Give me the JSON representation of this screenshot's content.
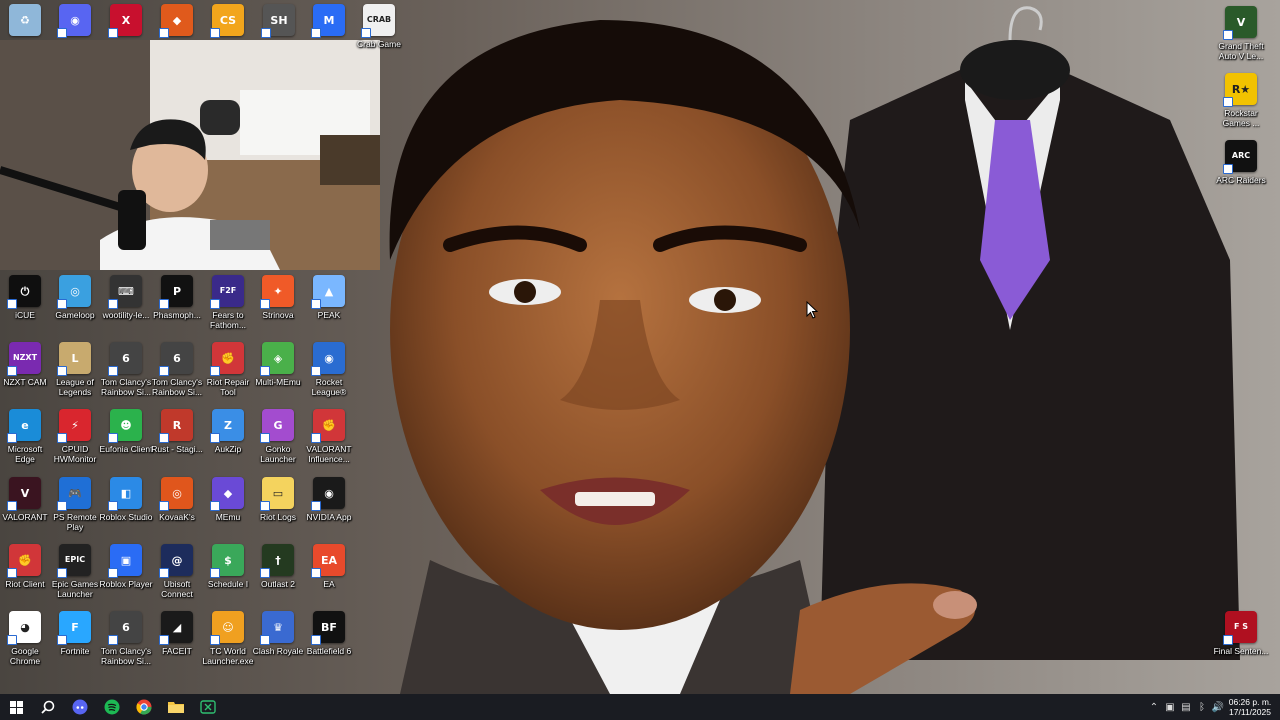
{
  "desktop": {
    "top_row": [
      {
        "name": "recycle-bin",
        "label": "",
        "color": "#8fb7d9",
        "glyph": "♻"
      },
      {
        "name": "discord",
        "label": "",
        "color": "#5865f2",
        "glyph": "◉"
      },
      {
        "name": "app-red-x",
        "label": "",
        "color": "#c8102e",
        "glyph": "X"
      },
      {
        "name": "app-shield",
        "label": "",
        "color": "#e05a1c",
        "glyph": "◆"
      },
      {
        "name": "counter-strike",
        "label": "",
        "color": "#f2a51c",
        "glyph": "CS"
      },
      {
        "name": "silent-hill",
        "label": "",
        "color": "#555",
        "glyph": "SH"
      },
      {
        "name": "app-m",
        "label": "",
        "color": "#2a6cf5",
        "glyph": "M"
      },
      {
        "name": "crab-game",
        "label": "Crab Game",
        "color": "#f0f0f0",
        "glyph": "CRAB"
      }
    ],
    "grid": [
      [
        {
          "label": "iCUE",
          "color": "#0f0f0f",
          "glyph": "⏻"
        },
        {
          "label": "Gameloop",
          "color": "#3aa0e0",
          "glyph": "◎"
        },
        {
          "label": "wootility-le...",
          "color": "#333",
          "glyph": "⌨"
        },
        {
          "label": "Phasmoph...",
          "color": "#111",
          "glyph": "P"
        },
        {
          "label": "Fears to Fathom...",
          "color": "#3a2a8a",
          "glyph": "F2F"
        },
        {
          "label": "Strinova",
          "color": "#f05a28",
          "glyph": "✦"
        },
        {
          "label": "PEAK",
          "color": "#7ab7ff",
          "glyph": "▲"
        }
      ],
      [
        {
          "label": "NZXT CAM",
          "color": "#7a2ab0",
          "glyph": "NZXT"
        },
        {
          "label": "League of Legends",
          "color": "#c8aa6e",
          "glyph": "L"
        },
        {
          "label": "Tom Clancy's Rainbow Si...",
          "color": "#444",
          "glyph": "6"
        },
        {
          "label": "Tom Clancy's Rainbow Si...",
          "color": "#444",
          "glyph": "6"
        },
        {
          "label": "Riot Repair Tool",
          "color": "#d13639",
          "glyph": "✊"
        },
        {
          "label": "Multi-MEmu",
          "color": "#4ab04a",
          "glyph": "◈"
        },
        {
          "label": "Rocket League®",
          "color": "#2a6cd1",
          "glyph": "◉"
        }
      ],
      [
        {
          "label": "Microsoft Edge",
          "color": "#1a8cd8",
          "glyph": "e"
        },
        {
          "label": "CPUID HWMonitor",
          "color": "#d9262e",
          "glyph": "⚡"
        },
        {
          "label": "Eufonia Client",
          "color": "#2bb24c",
          "glyph": "☻"
        },
        {
          "label": "Rust - Stagi...",
          "color": "#c0392b",
          "glyph": "R"
        },
        {
          "label": "AukZip",
          "color": "#3a8ee6",
          "glyph": "Z"
        },
        {
          "label": "Gonko Launcher",
          "color": "#a34ccf",
          "glyph": "G"
        },
        {
          "label": "VALORANT Influence...",
          "color": "#d13639",
          "glyph": "✊"
        }
      ],
      [
        {
          "label": "VALORANT",
          "color": "#3a1420",
          "glyph": "V"
        },
        {
          "label": "PS Remote Play",
          "color": "#1f6fd6",
          "glyph": "🎮"
        },
        {
          "label": "Roblox Studio",
          "color": "#2b8ae6",
          "glyph": "◧"
        },
        {
          "label": "KovaaK's",
          "color": "#e0561c",
          "glyph": "◎"
        },
        {
          "label": "MEmu",
          "color": "#6a4ad6",
          "glyph": "◆"
        },
        {
          "label": "Riot Logs",
          "color": "#f4d35e",
          "glyph": "▭"
        },
        {
          "label": "NVIDIA App",
          "color": "#1a1a1a",
          "glyph": "◉"
        }
      ],
      [
        {
          "label": "Riot Client",
          "color": "#d13639",
          "glyph": "✊"
        },
        {
          "label": "Epic Games Launcher",
          "color": "#222",
          "glyph": "EPIC"
        },
        {
          "label": "Roblox Player",
          "color": "#2a6cf5",
          "glyph": "▣"
        },
        {
          "label": "Ubisoft Connect",
          "color": "#1d2c5c",
          "glyph": "@"
        },
        {
          "label": "Schedule I",
          "color": "#3aa85a",
          "glyph": "$"
        },
        {
          "label": "Outlast 2",
          "color": "#243a20",
          "glyph": "†"
        },
        {
          "label": "EA",
          "color": "#e84a2c",
          "glyph": "EA"
        }
      ],
      [
        {
          "label": "Google Chrome",
          "color": "#ffffff",
          "glyph": "◕"
        },
        {
          "label": "Fortnite",
          "color": "#29a7ff",
          "glyph": "F"
        },
        {
          "label": "Tom Clancy's Rainbow Si...",
          "color": "#444",
          "glyph": "6"
        },
        {
          "label": "FACEIT",
          "color": "#1a1a1a",
          "glyph": "◢"
        },
        {
          "label": "TC World Launcher.exe",
          "color": "#f0a020",
          "glyph": "☺"
        },
        {
          "label": "Clash Royale",
          "color": "#3a6ad1",
          "glyph": "♛"
        },
        {
          "label": "Battlefield 6",
          "color": "#111",
          "glyph": "BF"
        }
      ]
    ],
    "right_col": [
      {
        "label": "Grand Theft Auto V Le...",
        "color": "#2a5a2a",
        "glyph": "V"
      },
      {
        "label": "Rockstar Games ...",
        "color": "#f2c200",
        "glyph": "R★"
      },
      {
        "label": "ARC Raiders",
        "color": "#111",
        "glyph": "ARC"
      }
    ],
    "bottom_right": {
      "label": "Final Senten...",
      "color": "#b01020",
      "glyph": "F S"
    }
  },
  "taskbar": {
    "apps": [
      "start-icon",
      "search-icon",
      "discord-icon",
      "spotify-icon",
      "chrome-icon",
      "file-explorer-icon",
      "xbox-app-icon"
    ],
    "clock": {
      "time": "06:26 p. m.",
      "date": "17/11/2025"
    }
  }
}
